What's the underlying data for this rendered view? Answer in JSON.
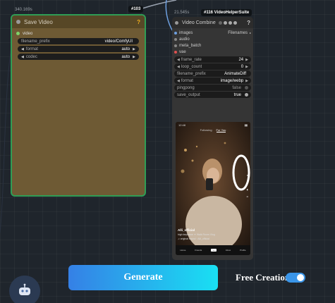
{
  "save_node": {
    "time": "340.169s",
    "id": "#103",
    "title": "Save Video",
    "help": "?",
    "input_label": "video",
    "widgets": [
      {
        "label": "filename_prefix",
        "value": "video/ComfyUI"
      },
      {
        "label": "format",
        "value": "auto"
      },
      {
        "label": "codec",
        "value": "auto"
      }
    ]
  },
  "combine_node": {
    "time": "21.545s",
    "id": "#116 VideoHelperSuite",
    "title": "Video Combine",
    "help": "?",
    "inputs": [
      {
        "label": "images",
        "extra": "Filenames",
        "color": "#6ea0e0"
      },
      {
        "label": "audio",
        "extra": "",
        "color": "#888888"
      },
      {
        "label": "meta_batch",
        "extra": "",
        "color": "#888888"
      },
      {
        "label": "vae",
        "extra": "",
        "color": "#e05050"
      }
    ],
    "widgets": [
      {
        "label": "frame_rate",
        "value": "24"
      },
      {
        "label": "loop_count",
        "value": "0"
      },
      {
        "label": "filename_prefix",
        "value": "AnimateDiff"
      },
      {
        "label": "format",
        "value": "image/webp"
      },
      {
        "label": "pingpong",
        "value": "false"
      },
      {
        "label": "save_output",
        "value": "true"
      }
    ]
  },
  "preview": {
    "status_time": "12:48",
    "tab_following": "Following",
    "tab_foryou": "For You",
    "username": "Alli_official",
    "caption": "high keyframe ✦ Walk Room Vlog",
    "sound": "♫ original sound · Alli_official",
    "nav": [
      "Home",
      "Friends",
      "+",
      "Inbox",
      "Profile"
    ]
  },
  "bottom": {
    "generate_label": "Generate",
    "free_creation_label": "Free Creation",
    "free_creation_on": true
  },
  "colors": {
    "accent_gradient_start": "#3580e6",
    "accent_gradient_end": "#19e0f3",
    "save_node_body": "#6e5a34",
    "save_node_border": "#2f9d55"
  }
}
